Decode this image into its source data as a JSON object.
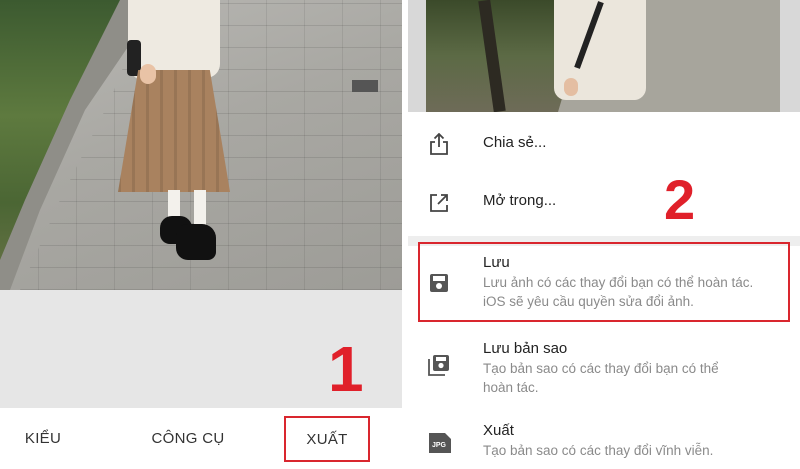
{
  "left": {
    "tabs": [
      {
        "label": "KIỂU"
      },
      {
        "label": "CÔNG CỤ"
      },
      {
        "label": "XUẤT"
      }
    ],
    "step_marker": "1",
    "highlight_color": "#d9262e"
  },
  "right": {
    "step_marker": "2",
    "menu": {
      "share": {
        "title": "Chia sẻ...",
        "icon": "share-icon"
      },
      "open_in": {
        "title": "Mở trong...",
        "icon": "open-external-icon"
      },
      "save": {
        "title": "Lưu",
        "desc_line1": "Lưu ảnh có các thay đổi bạn có thể hoàn tác.",
        "desc_line2": "iOS sẽ yêu cầu quyền sửa đổi ảnh.",
        "icon": "save-icon"
      },
      "save_copy": {
        "title": "Lưu bản sao",
        "desc_line1": "Tạo bản sao có các thay đổi bạn có thể",
        "desc_line2": "hoàn tác.",
        "icon": "save-copy-icon"
      },
      "export": {
        "title": "Xuất",
        "desc_line1": "Tạo bản sao có các thay đổi vĩnh viễn.",
        "icon": "jpg-icon",
        "icon_text": "JPG"
      }
    }
  },
  "colors": {
    "accent_red": "#e0202a",
    "menu_title": "#222222",
    "menu_desc": "#8a8a8a"
  }
}
